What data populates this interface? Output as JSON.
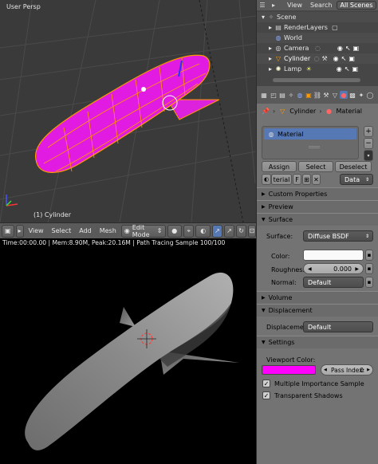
{
  "viewport3d": {
    "view_label": "User Persp",
    "object_label": "(1) Cylinder",
    "header": {
      "view": "View",
      "select": "Select",
      "add": "Add",
      "mesh": "Mesh",
      "mode": "Edit Mode"
    }
  },
  "render": {
    "status": "Time:00:00.00 | Mem:8.90M, Peak:20.16M | Path Tracing Sample 100/100"
  },
  "outliner": {
    "header": {
      "view": "View",
      "search": "Search",
      "scenes": "All Scenes"
    },
    "items": [
      {
        "label": "Scene"
      },
      {
        "label": "RenderLayers"
      },
      {
        "label": "World"
      },
      {
        "label": "Camera"
      },
      {
        "label": "Cylinder"
      },
      {
        "label": "Lamp"
      }
    ]
  },
  "properties": {
    "breadcrumb_object": "Cylinder",
    "breadcrumb_material": "Material",
    "slot_name": "Material",
    "assign": "Assign",
    "select": "Select",
    "deselect": "Deselect",
    "mat_field": "terial",
    "mat_f": "F",
    "link": "Data",
    "panels": {
      "custom": "Custom Properties",
      "preview": "Preview",
      "surface": "Surface",
      "volume": "Volume",
      "displacement": "Displacement",
      "settings": "Settings"
    },
    "surface_label": "Surface:",
    "surface_value": "Diffuse BSDF",
    "color_label": "Color:",
    "roughness_label": "Roughness",
    "roughness_value": "0.000",
    "normal_label": "Normal:",
    "normal_value": "Default",
    "displace_label": "Displaceme",
    "displace_value": "Default",
    "viewport_color_label": "Viewport Color:",
    "viewport_color": "#ff00ff",
    "pass_index": "Pass Index:",
    "pass_value": "0",
    "mis_label": "Multiple Importance Sample",
    "transparent_label": "Transparent Shadows"
  }
}
